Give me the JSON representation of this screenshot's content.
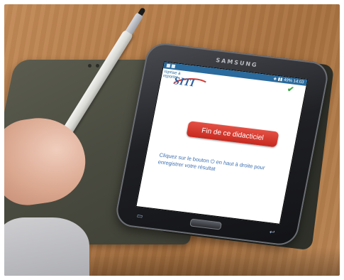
{
  "phone": {
    "brand": "SAMSUNG",
    "status_time": "14:03",
    "status_icons": "◈ ▮▮ 49%",
    "reprise_label": "reprise à reporter",
    "logo_text": "SITI",
    "end_button_label": "Fin de ce didacticiel",
    "instruction_text": "Cliquez sur le bouton ⏻ en haut à droite pour enregistrer votre résultat",
    "softkeys": {
      "back_icon": "↩",
      "menu_icon": "▭"
    }
  },
  "colors": {
    "button_red": "#d33a32",
    "logo_blue": "#2f5fa0",
    "status_blue": "#2a6a9c",
    "check_green": "#3aa547"
  },
  "icons": [
    "check-icon",
    "power-icon",
    "back-icon",
    "menu-icon",
    "home-button"
  ]
}
